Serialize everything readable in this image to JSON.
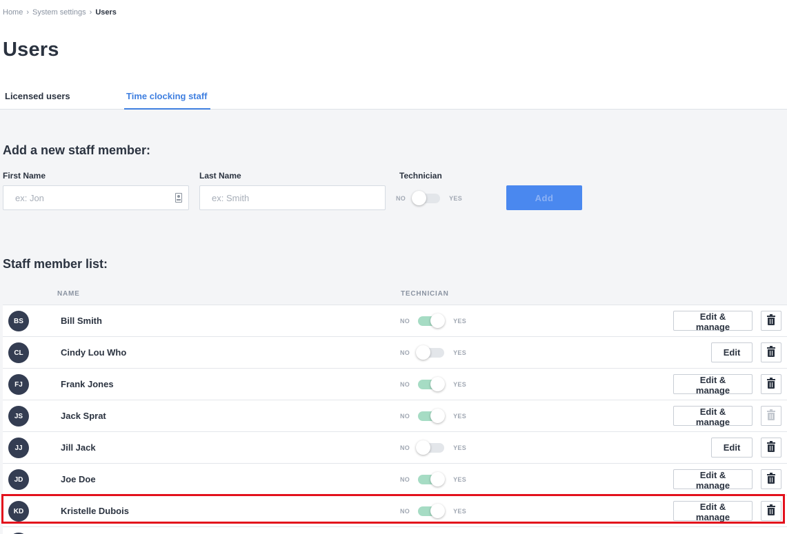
{
  "breadcrumb": {
    "home": "Home",
    "settings": "System settings",
    "current": "Users",
    "separator": "›"
  },
  "page_title": "Users",
  "tabs": {
    "licensed": "Licensed users",
    "time_clocking": "Time clocking staff"
  },
  "add_section": {
    "title": "Add a new staff member:",
    "first_name_label": "First Name",
    "first_name_placeholder": "ex: Jon",
    "last_name_label": "Last Name",
    "last_name_placeholder": "ex: Smith",
    "technician_label": "Technician",
    "technician_on": false,
    "no": "NO",
    "yes": "YES",
    "add_button": "Add"
  },
  "list_section": {
    "title": "Staff member list:",
    "col_name": "NAME",
    "col_technician": "TECHNICIAN",
    "no": "NO",
    "yes": "YES",
    "edit_manage_label": "Edit & manage",
    "edit_label": "Edit",
    "rows": [
      {
        "initials": "BS",
        "name": "Bill Smith",
        "technician": true,
        "delete_enabled": true
      },
      {
        "initials": "CL",
        "name": "Cindy Lou Who",
        "technician": false,
        "delete_enabled": true
      },
      {
        "initials": "FJ",
        "name": "Frank Jones",
        "technician": true,
        "delete_enabled": true
      },
      {
        "initials": "JS",
        "name": "Jack Sprat",
        "technician": true,
        "delete_enabled": false
      },
      {
        "initials": "JJ",
        "name": "Jill Jack",
        "technician": false,
        "delete_enabled": true
      },
      {
        "initials": "JD",
        "name": "Joe Doe",
        "technician": true,
        "delete_enabled": true
      },
      {
        "initials": "KD",
        "name": "Kristelle Dubois",
        "technician": true,
        "delete_enabled": true,
        "highlighted": true
      }
    ]
  },
  "colors": {
    "accent": "#3f7fe0",
    "add_button": "#4a88ef",
    "toggle_on": "#a6dcc4",
    "avatar": "#343d52",
    "highlight": "#e3101c"
  }
}
